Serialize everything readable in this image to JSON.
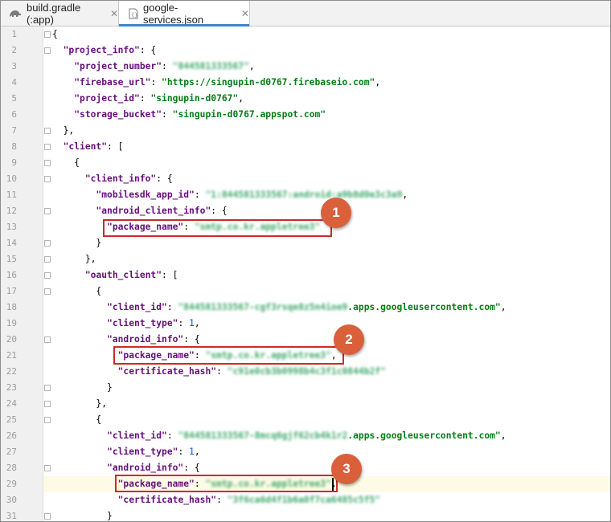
{
  "tabs": [
    {
      "label": "build.gradle (:app)",
      "icon": "gradle-icon",
      "active": false
    },
    {
      "label": "google-services.json",
      "icon": "json-file-icon",
      "active": true
    }
  ],
  "code_lines": [
    {
      "n": "1",
      "html": "<span class=\"p\">{</span>"
    },
    {
      "n": "2",
      "html": "  <span class=\"k\">\"project_info\"</span><span class=\"p\">: {</span>"
    },
    {
      "n": "3",
      "html": "    <span class=\"k\">\"project_number\"</span><span class=\"p\">: </span><span class=\"blur\">\"844581333567\"</span><span class=\"p\">,</span>"
    },
    {
      "n": "4",
      "html": "    <span class=\"k\">\"firebase_url\"</span><span class=\"p\">: </span><span class=\"s\">\"https://singupin-d0767.firebaseio.com\"</span><span class=\"p\">,</span>"
    },
    {
      "n": "5",
      "html": "    <span class=\"k\">\"project_id\"</span><span class=\"p\">: </span><span class=\"s\">\"singupin-d0767\"</span><span class=\"p\">,</span>"
    },
    {
      "n": "6",
      "html": "    <span class=\"k\">\"storage_bucket\"</span><span class=\"p\">: </span><span class=\"s\">\"singupin-d0767.appspot.com\"</span>"
    },
    {
      "n": "7",
      "html": "  <span class=\"p\">},</span>"
    },
    {
      "n": "8",
      "html": "  <span class=\"k\">\"client\"</span><span class=\"p\">: [</span>"
    },
    {
      "n": "9",
      "html": "    <span class=\"p\">{</span>"
    },
    {
      "n": "10",
      "html": "      <span class=\"k\">\"client_info\"</span><span class=\"p\">: {</span>"
    },
    {
      "n": "11",
      "html": "        <span class=\"k\">\"mobilesdk_app_id\"</span><span class=\"p\">: </span><span class=\"blur\">\"1:844581333567:android:a9b8d0e3c3a9</span><span class=\"p\">,</span>"
    },
    {
      "n": "12",
      "html": "        <span class=\"k\">\"android_client_info\"</span><span class=\"p\">: {</span>"
    },
    {
      "n": "13",
      "html": "          <span class=\"k\">\"package_name\"</span><span class=\"p\">: </span><span class=\"blur\">\"smtp.co.kr.appletree3\"</span>"
    },
    {
      "n": "14",
      "html": "        <span class=\"p\">}</span>"
    },
    {
      "n": "15",
      "html": "      <span class=\"p\">},</span>"
    },
    {
      "n": "16",
      "html": "      <span class=\"k\">\"oauth_client\"</span><span class=\"p\">: [</span>"
    },
    {
      "n": "17",
      "html": "        <span class=\"p\">{</span>"
    },
    {
      "n": "18",
      "html": "          <span class=\"k\">\"client_id\"</span><span class=\"p\">: </span><span class=\"blur\">\"844581333567-cgf3rsqe8z5n4ioe9</span><span class=\"s\">.apps.googleusercontent.com\"</span><span class=\"p\">,</span>"
    },
    {
      "n": "19",
      "html": "          <span class=\"k\">\"client_type\"</span><span class=\"p\">: </span><span class=\"n\">1</span><span class=\"p\">,</span>"
    },
    {
      "n": "20",
      "html": "          <span class=\"k\">\"android_info\"</span><span class=\"p\">: {</span>"
    },
    {
      "n": "21",
      "html": "            <span class=\"k\">\"package_name\"</span><span class=\"p\">: </span><span class=\"blur\">\"smtp.co.kr.appletree3\"</span><span class=\"p\">,</span>"
    },
    {
      "n": "22",
      "html": "            <span class=\"k\">\"certificate_hash\"</span><span class=\"p\">: </span><span class=\"blur\">\"c91e0cb3b0998b4c3f1c0844b2f\"</span>"
    },
    {
      "n": "23",
      "html": "          <span class=\"p\">}</span>"
    },
    {
      "n": "24",
      "html": "        <span class=\"p\">},</span>"
    },
    {
      "n": "25",
      "html": "        <span class=\"p\">{</span>"
    },
    {
      "n": "26",
      "html": "          <span class=\"k\">\"client_id\"</span><span class=\"p\">: </span><span class=\"blur\">\"844581333567-8mcq6gjf62cb4k1r2</span><span class=\"s\">.apps.googleusercontent.com\"</span><span class=\"p\">,</span>"
    },
    {
      "n": "27",
      "html": "          <span class=\"k\">\"client_type\"</span><span class=\"p\">: </span><span class=\"n\">1</span><span class=\"p\">,</span>"
    },
    {
      "n": "28",
      "html": "          <span class=\"k\">\"android_info\"</span><span class=\"p\">: {</span>"
    },
    {
      "n": "29",
      "html": "            <span class=\"k\">\"package_name\"</span><span class=\"p\">: </span><span class=\"blur\">\"smtp.co.kr.appletree3\"</span><span class=\"p\">,</span>"
    },
    {
      "n": "30",
      "html": "            <span class=\"k\">\"certificate_hash\"</span><span class=\"p\">: </span><span class=\"blur\">\"3f6ca6d4f1b6a0f7ca6485c5f5\"</span>"
    },
    {
      "n": "31",
      "html": "          <span class=\"p\">}</span>"
    }
  ],
  "badges": [
    {
      "label": "1"
    },
    {
      "label": "2"
    },
    {
      "label": "3"
    }
  ],
  "colors": {
    "key": "#660e7a",
    "string": "#067d17",
    "number": "#1750eb",
    "highlight_box": "#cc2a2a",
    "badge": "#d9603b",
    "active_tab_underline": "#4083c9"
  }
}
